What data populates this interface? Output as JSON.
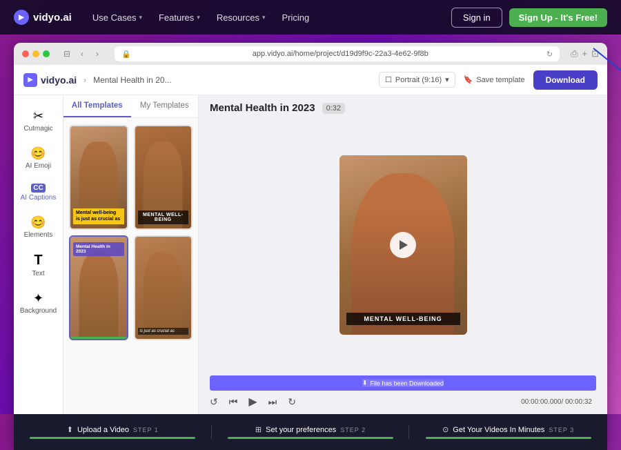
{
  "top_nav": {
    "logo": "vidyo.ai",
    "items": [
      {
        "label": "Use Cases",
        "has_dropdown": true
      },
      {
        "label": "Features",
        "has_dropdown": true
      },
      {
        "label": "Resources",
        "has_dropdown": true
      },
      {
        "label": "Pricing",
        "has_dropdown": false
      }
    ],
    "sign_in": "Sign in",
    "sign_up": "Sign Up - It's Free!"
  },
  "browser": {
    "url": "app.vidyo.ai/home/project/d19d9f9c-22a3-4e62-9f8b"
  },
  "app_header": {
    "logo": "vidyo.ai",
    "breadcrumb": "Mental Health in 20...",
    "portrait_label": "Portrait (9:16)",
    "save_template": "Save template",
    "download": "Download"
  },
  "sidebar": {
    "items": [
      {
        "label": "Cutmagic",
        "icon": "✂"
      },
      {
        "label": "AI Emoji",
        "icon": "😊"
      },
      {
        "label": "AI Captions",
        "icon": "CC"
      },
      {
        "label": "Elements",
        "icon": "😊"
      },
      {
        "label": "Text",
        "icon": "T"
      },
      {
        "label": "Background",
        "icon": "✦"
      }
    ]
  },
  "templates": {
    "tab_all": "All Templates",
    "tab_my": "My Templates",
    "cards": [
      {
        "id": 1,
        "overlay": "Mental well-being is just as crucial as",
        "type": "yellow"
      },
      {
        "id": 2,
        "overlay": "MENTAL WELL-BEING",
        "type": "dark"
      },
      {
        "id": 3,
        "overlay": "Mental Health in 2023",
        "type": "purple",
        "selected": true,
        "has_green_bar": true
      },
      {
        "id": 4,
        "overlay": "is just as crucial as",
        "type": "small"
      }
    ]
  },
  "preview": {
    "title": "Mental Health in 2023",
    "duration": "0:32",
    "caption": "MENTAL WELL-BEING",
    "time_current": "00:00:00.000",
    "time_total": "00:00:32",
    "download_badge": "File has been Downloaded"
  },
  "steps": [
    {
      "icon": "⬆",
      "label": "Upload a Video",
      "step": "STEP 1",
      "progress": 100
    },
    {
      "icon": "⊞",
      "label": "Set your preferences",
      "step": "STEP 2",
      "progress": 100
    },
    {
      "icon": "⊙",
      "label": "Get Your Videos In Minutes",
      "step": "STEP 3",
      "progress": 100
    }
  ]
}
